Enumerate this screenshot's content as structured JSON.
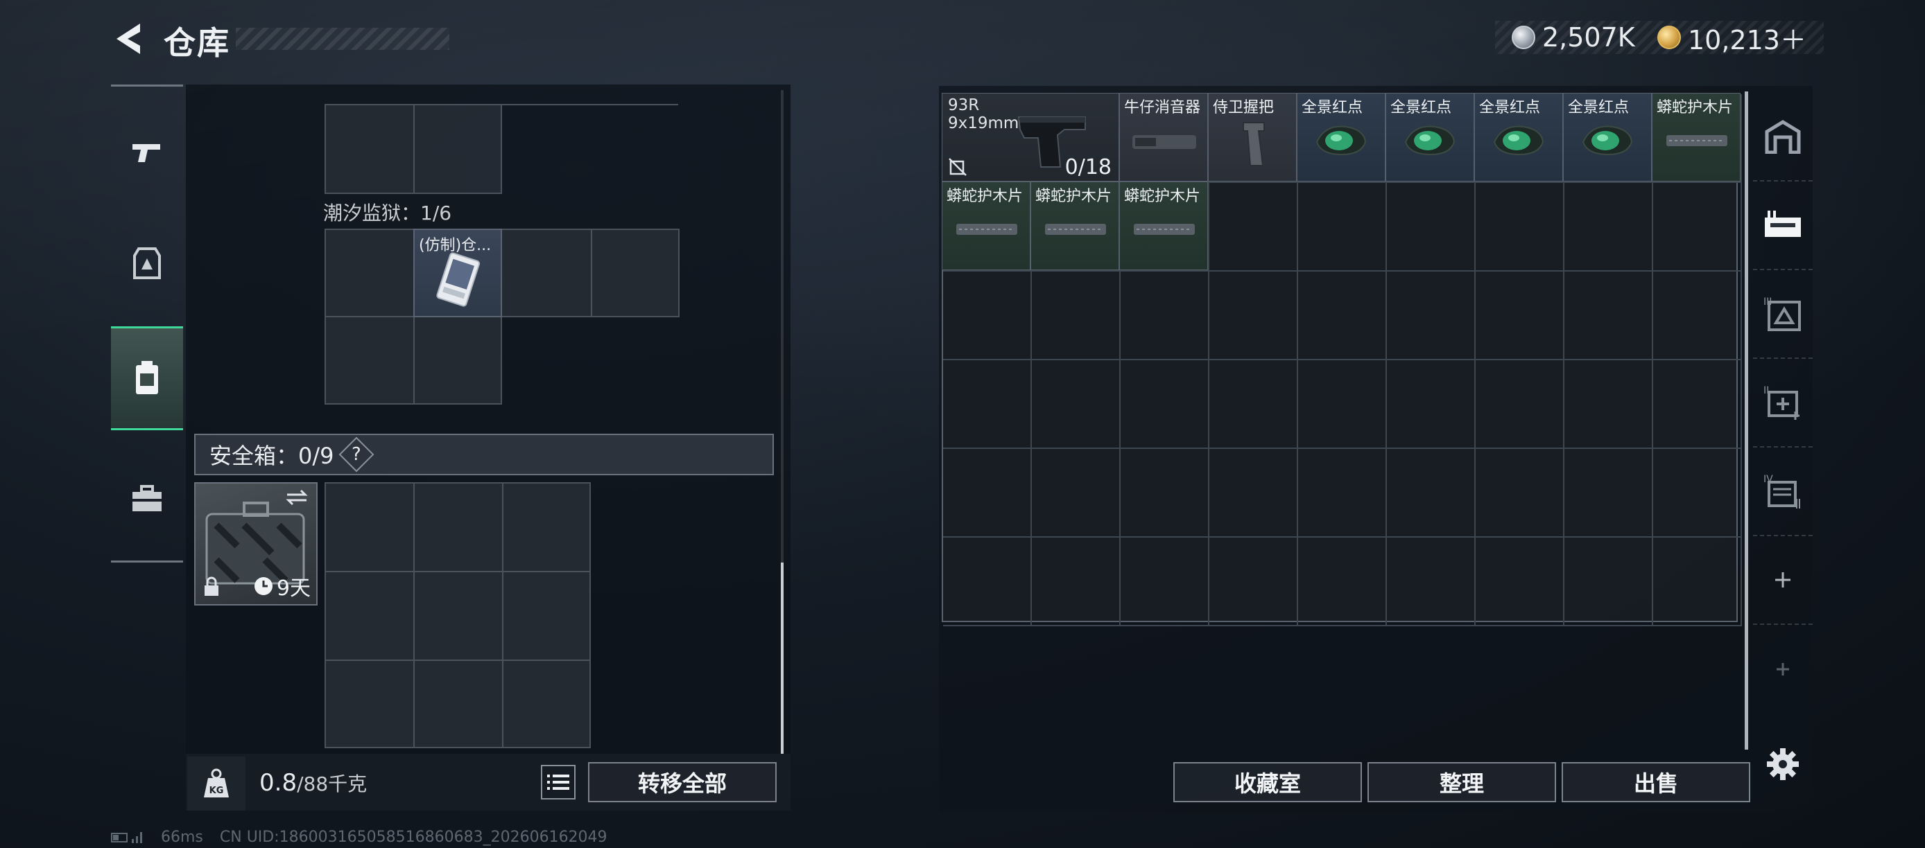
{
  "header": {
    "title": "仓库"
  },
  "currency": {
    "silver": "2,507K",
    "gold": "10,213＋"
  },
  "left_nav": [
    "gun-icon",
    "armor-icon",
    "backpack-icon",
    "toolbox-icon"
  ],
  "left_panel": {
    "prison_label": "潮汐监狱：1/6",
    "item_card_label": "(仿制)仓...",
    "safebox_label": "安全箱：0/9",
    "help": "?",
    "safebox_days": "9天",
    "weight_value": "0.8",
    "weight_max": "/88千克",
    "transfer_all": "转移全部"
  },
  "stash": {
    "gun_name": "93R",
    "gun_caliber": "9x19mm",
    "gun_ammo": "0/18",
    "items": [
      {
        "label": "牛仔消音器",
        "color": "grey"
      },
      {
        "label": "侍卫握把",
        "color": "grey"
      },
      {
        "label": "全景红点",
        "color": "blue"
      },
      {
        "label": "全景红点",
        "color": "blue"
      },
      {
        "label": "全景红点",
        "color": "blue"
      },
      {
        "label": "全景红点",
        "color": "blue"
      },
      {
        "label": "蟒蛇护木片",
        "color": "green"
      },
      {
        "label": "蟒蛇护木片",
        "color": "green"
      },
      {
        "label": "蟒蛇护木片",
        "color": "green"
      },
      {
        "label": "蟒蛇护木片",
        "color": "green"
      }
    ]
  },
  "buttons": {
    "collection": "收藏室",
    "organize": "整理",
    "sell": "出售"
  },
  "right_tabs": [
    "safehouse-icon",
    "stash-tab-1-icon",
    "stash-tab-3-icon",
    "stash-tab-2-icon",
    "stash-tab-4-icon",
    "add-tab-icon",
    "add-tab-disabled-icon"
  ],
  "footer": {
    "ping": "66ms",
    "uid": "CN UID:18600316505851686068​3_202606162049"
  },
  "colors": {
    "accent_green": "#3fd99a",
    "panel": "#0e141b"
  }
}
